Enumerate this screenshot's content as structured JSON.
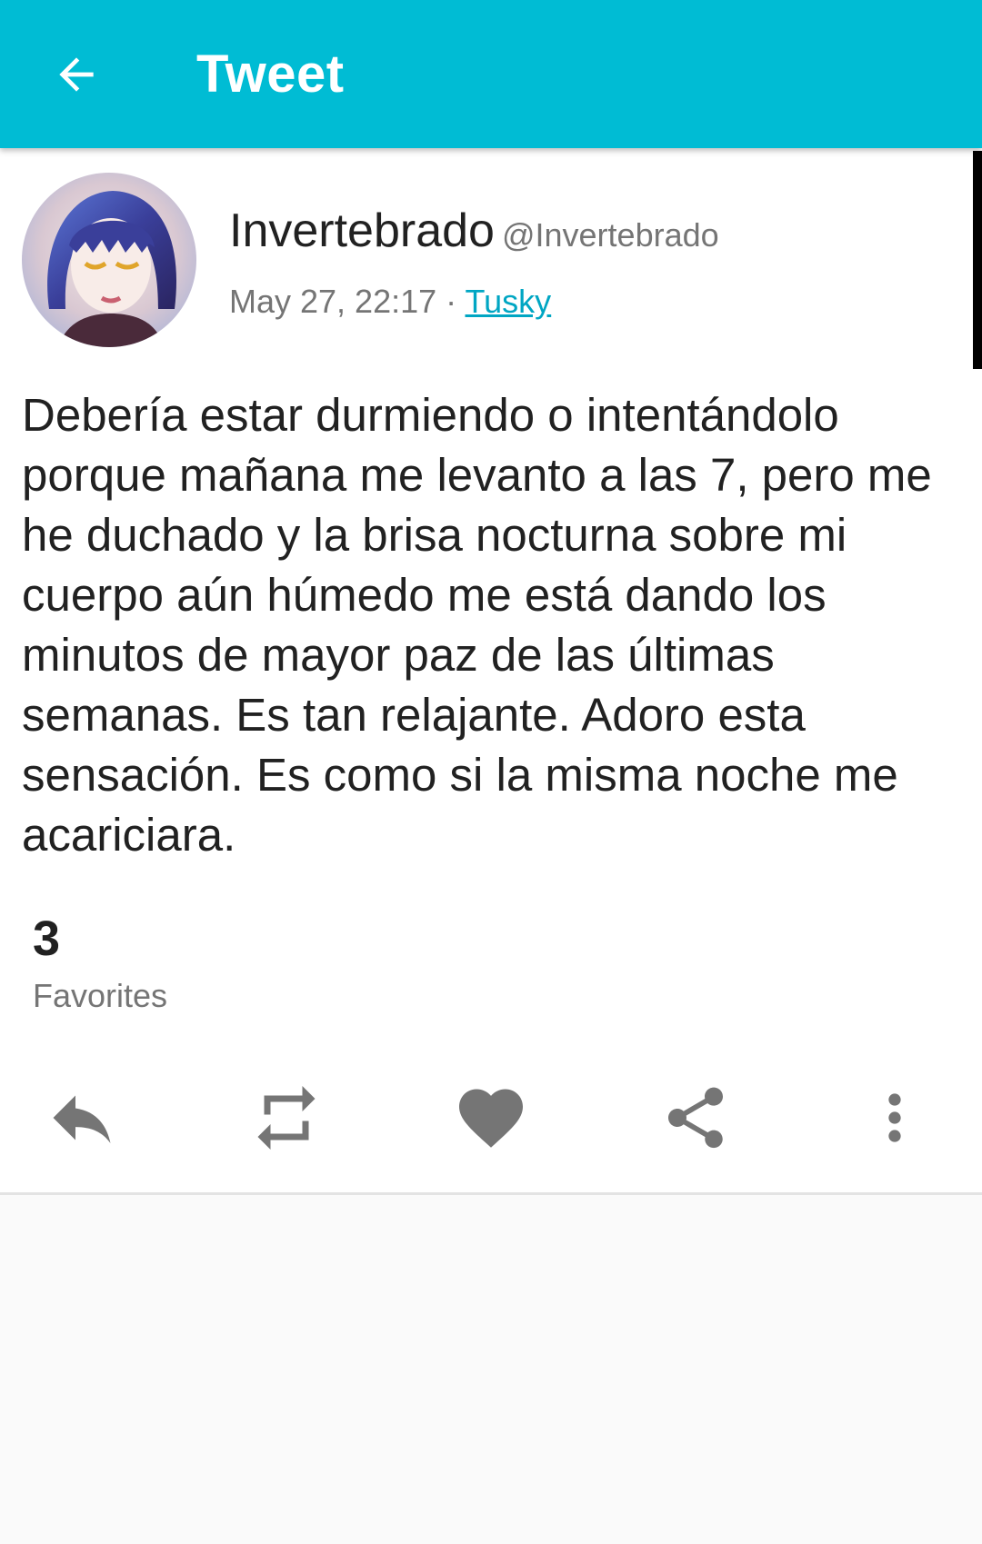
{
  "appbar": {
    "title": "Tweet",
    "back_icon": "arrow-back-icon",
    "background": "#00bcd4"
  },
  "status": {
    "display_name": "Invertebrado",
    "username": "@Invertebrado",
    "timestamp": "May 27, 22:17",
    "separator": " · ",
    "application": "Tusky",
    "content": "Debería estar durmiendo o intentándolo porque mañana me levanto a las 7, pero me he duchado y la brisa nocturna sobre mi cuerpo aún húmedo me está dando los minutos de mayor paz de las últimas semanas. Es tan relajante. Adoro esta sensación. Es como si la misma noche me acariciara."
  },
  "stats": {
    "favorites_count": "3",
    "favorites_label": "Favorites"
  },
  "actions": [
    {
      "name": "reply",
      "icon": "reply-icon"
    },
    {
      "name": "reblog",
      "icon": "repeat-icon"
    },
    {
      "name": "favourite",
      "icon": "heart-icon"
    },
    {
      "name": "share",
      "icon": "share-icon"
    },
    {
      "name": "more",
      "icon": "more-vert-icon"
    }
  ],
  "colors": {
    "accent": "#00bcd4",
    "link": "#00a6c3",
    "icon": "#757575",
    "text_primary": "#212121",
    "text_secondary": "#757575"
  }
}
